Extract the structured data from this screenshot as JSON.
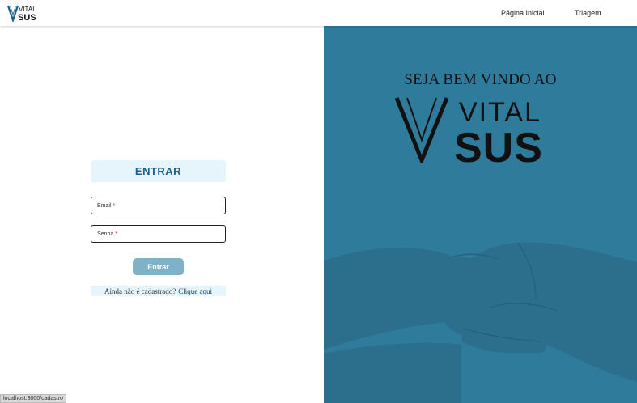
{
  "header": {
    "logo": {
      "vital": "VITAL",
      "sus": "SUS"
    },
    "nav": [
      {
        "label": "Página Inicial"
      },
      {
        "label": "Triagem"
      }
    ]
  },
  "login": {
    "title": "ENTRAR",
    "email_label": "Email",
    "password_label": "Senha",
    "required_mark": "*",
    "submit_label": "Entrar",
    "signup_prompt": "Ainda não é cadastrado?",
    "signup_link": "Clique aqui"
  },
  "hero": {
    "welcome": "SEJA BEM VINDO AO",
    "logo": {
      "vital": "VITAL",
      "sus": "SUS"
    }
  },
  "status_bar": {
    "url": "localhost:3000/cadastro"
  },
  "colors": {
    "accent": "#1d5f86",
    "panel": "#2f7b9c",
    "title_bg": "#e6f4fb",
    "button": "#7fb1c9"
  }
}
